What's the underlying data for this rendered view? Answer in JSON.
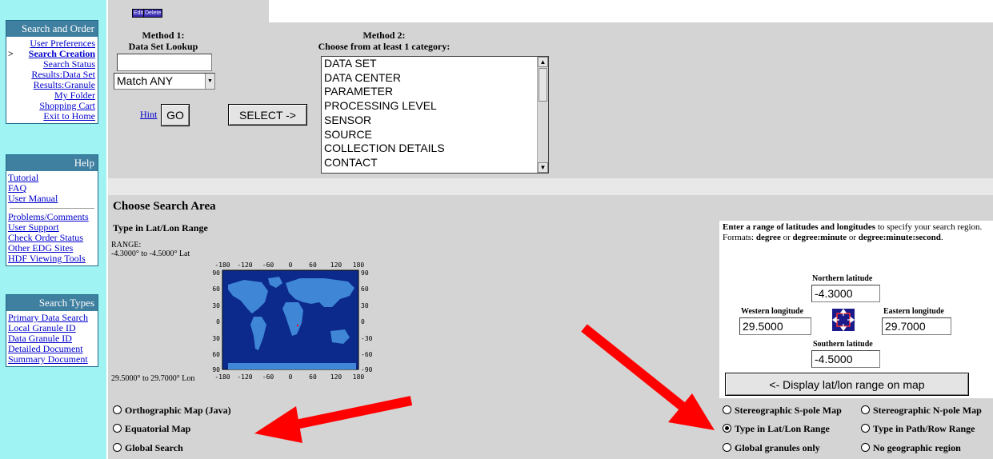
{
  "top_buttons": {
    "edit": "Edit",
    "delete": "Delete"
  },
  "sidebar": {
    "search_order": {
      "title": "Search and Order",
      "current_marker": ">",
      "items": [
        "User Preferences",
        "Search Creation",
        "Search Status",
        "Results:Data Set",
        "Results:Granule",
        "My Folder",
        "Shopping Cart",
        "Exit to Home"
      ]
    },
    "help": {
      "title": "Help",
      "items": [
        "Tutorial",
        "FAQ",
        "User Manual"
      ],
      "items2": [
        "Problems/Comments",
        "User Support",
        "Check Order Status",
        "Other EDG Sites",
        "HDF Viewing Tools"
      ]
    },
    "search_types": {
      "title": "Search Types",
      "items": [
        "Primary Data Search",
        "Local Granule ID",
        "Data Granule ID",
        "Detailed Document",
        "Summary Document"
      ]
    }
  },
  "method1": {
    "title": "Method 1:",
    "subtitle": "Data Set Lookup",
    "input_value": "",
    "match_value": "Match ANY",
    "hint": "Hint",
    "go": "GO"
  },
  "method2": {
    "title": "Method 2:",
    "subtitle": "Choose from at least 1 category:",
    "select_button": "SELECT ->",
    "categories": [
      "DATA SET",
      "DATA CENTER",
      "PARAMETER",
      "PROCESSING LEVEL",
      "SENSOR",
      "SOURCE",
      "COLLECTION DETAILS",
      "CONTACT"
    ]
  },
  "search_area": {
    "title": "Choose Search Area",
    "subtitle": "Type in Lat/Lon Range",
    "range_label": "RANGE:",
    "lat_range": "-4.3000° to -4.5000° Lat",
    "lon_range": "29.5000° to 29.7000° Lon",
    "map_x_ticks": [
      "-180",
      "-120",
      "-60",
      "0",
      "60",
      "120",
      "180"
    ],
    "map_y_ticks": [
      "90",
      "60",
      "30",
      "0",
      "-30",
      "-60",
      "-90"
    ]
  },
  "instructions": {
    "bold1": "Enter a range of latitudes and longitudes",
    "text1": " to specify your search region. Formats: ",
    "bold2": "degree",
    "text2": " or ",
    "bold3": "degree:minute",
    "text3": " or ",
    "bold4": "degree:minute:second",
    "text4": "."
  },
  "latlon": {
    "north_label": "Northern latitude",
    "north_value": "-4.3000",
    "west_label": "Western longitude",
    "west_value": "29.5000",
    "east_label": "Eastern longitude",
    "east_value": "29.7000",
    "south_label": "Southern latitude",
    "south_value": "-4.5000",
    "display_button": "<- Display lat/lon range on map"
  },
  "map_options_left": [
    "Orthographic Map (Java)",
    "Equatorial Map",
    "Global Search"
  ],
  "map_options_right": [
    "Stereographic S-pole Map",
    "Stereographic N-pole Map",
    "Type in Lat/Lon Range",
    "Type in Path/Row Range",
    "Global granules only",
    "No geographic region"
  ],
  "selected_option": "Type in Lat/Lon Range",
  "colors": {
    "sidebar_bg": "#9ff3f3",
    "header_bg": "#3f7f9f",
    "panel_grey": "#d4d4d4",
    "map_ocean": "#0b2a8c",
    "map_land": "#3f86d6",
    "arrow": "#ff0000"
  }
}
